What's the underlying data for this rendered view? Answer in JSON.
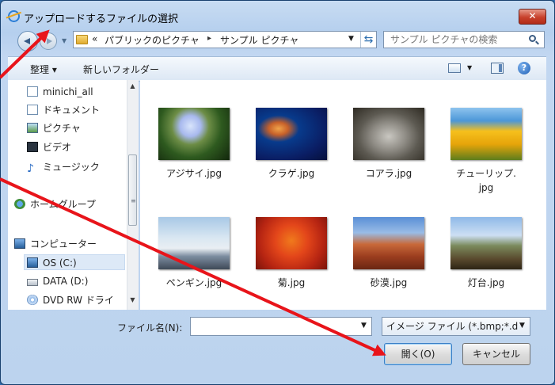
{
  "window": {
    "title": "アップロードするファイルの選択",
    "close_label": "✕"
  },
  "nav": {
    "breadcrumb_more": "«",
    "breadcrumb": [
      "パブリックのピクチャ",
      "サンプル ピクチャ"
    ],
    "breadcrumb_separator": "▸",
    "search_placeholder": "サンプル ピクチャの検索"
  },
  "toolbar": {
    "organize": "整理 ▾",
    "new_folder": "新しいフォルダー"
  },
  "sidebar": {
    "items": [
      {
        "label": "minichi_all",
        "icon": "document-icon"
      },
      {
        "label": "ドキュメント",
        "icon": "document-icon"
      },
      {
        "label": "ピクチャ",
        "icon": "picture-icon"
      },
      {
        "label": "ビデオ",
        "icon": "video-icon"
      },
      {
        "label": "ミュージック",
        "icon": "music-icon"
      },
      {
        "label": "ホームグループ",
        "icon": "homegroup-icon"
      },
      {
        "label": "コンピューター",
        "icon": "computer-icon"
      },
      {
        "label": "OS (C:)",
        "icon": "drive-icon"
      },
      {
        "label": "DATA (D:)",
        "icon": "drive-icon"
      },
      {
        "label": "DVD RW ドライ",
        "icon": "dvd-icon"
      }
    ]
  },
  "files": [
    {
      "name": "アジサイ.jpg"
    },
    {
      "name": "クラゲ.jpg"
    },
    {
      "name": "コアラ.jpg"
    },
    {
      "name": "チューリップ.",
      "name2": "jpg"
    },
    {
      "name": "ペンギン.jpg"
    },
    {
      "name": "菊.jpg"
    },
    {
      "name": "砂漠.jpg"
    },
    {
      "name": "灯台.jpg"
    }
  ],
  "footer": {
    "filename_label": "ファイル名(N):",
    "filename_value": "",
    "filetype": "イメージ ファイル (*.bmp;*.d",
    "open": "開く(O)",
    "cancel": "キャンセル"
  },
  "colors": {
    "annotation_arrow": "#e8141a",
    "accent": "#3b7fc6"
  }
}
